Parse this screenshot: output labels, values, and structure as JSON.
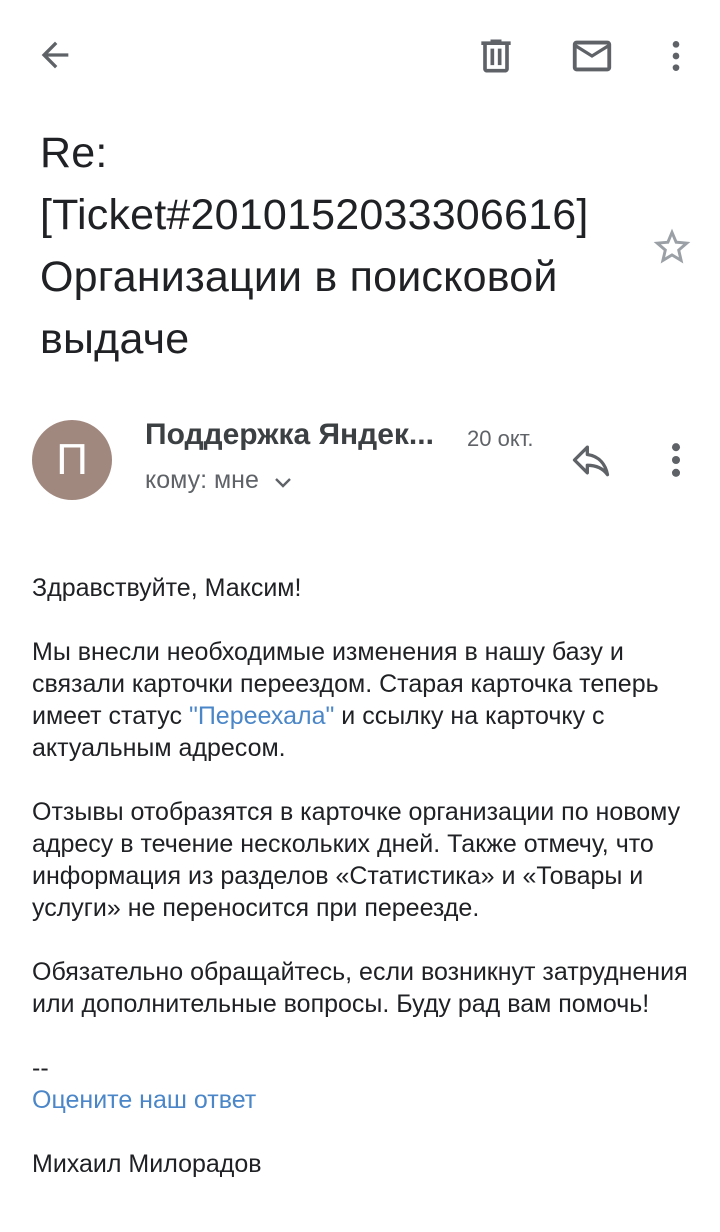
{
  "toolbar": {
    "back_icon": "arrow-left-icon",
    "delete_icon": "trash-icon",
    "mark_unread_icon": "mail-icon",
    "more_icon": "more-vertical-icon"
  },
  "email": {
    "subject_line1": "Re:",
    "subject_line2": "[Ticket#2010152033306616]",
    "subject_line3": "Организации в поисковой",
    "subject_line4": "выдаче",
    "star_icon": "star-outline-icon",
    "sender": {
      "avatar_letter": "П",
      "avatar_color": "#a1887f",
      "name": "Поддержка Яндек...",
      "date": "20 окт.",
      "recipient": "кому: мне"
    },
    "body": {
      "greeting": "Здравствуйте, Максим!",
      "p1_start": "Мы внесли необходимые изменения в нашу базу и связали карточки переездом. Старая карточка теперь имеет статус ",
      "p1_link": "\"Переехала\"",
      "p1_end": " и ссылку на карточку с актуальным адресом.",
      "p2": "Отзывы отобразятся в карточке организации по новому адресу в течение нескольких дней. Также отмечу, что информация из разделов «Статистика» и «Товары и услуги» не переносится при переезде.",
      "p3": "Обязательно обращайтесь, если возникнут затруднения или дополнительные вопросы. Буду рад вам помочь!",
      "signature_dash": "--",
      "rate_link": "Оцените наш ответ",
      "signature_name": "Михаил Милорадов"
    }
  },
  "colors": {
    "link": "#4a86c8",
    "icon": "#5f6368",
    "text": "#202124"
  }
}
